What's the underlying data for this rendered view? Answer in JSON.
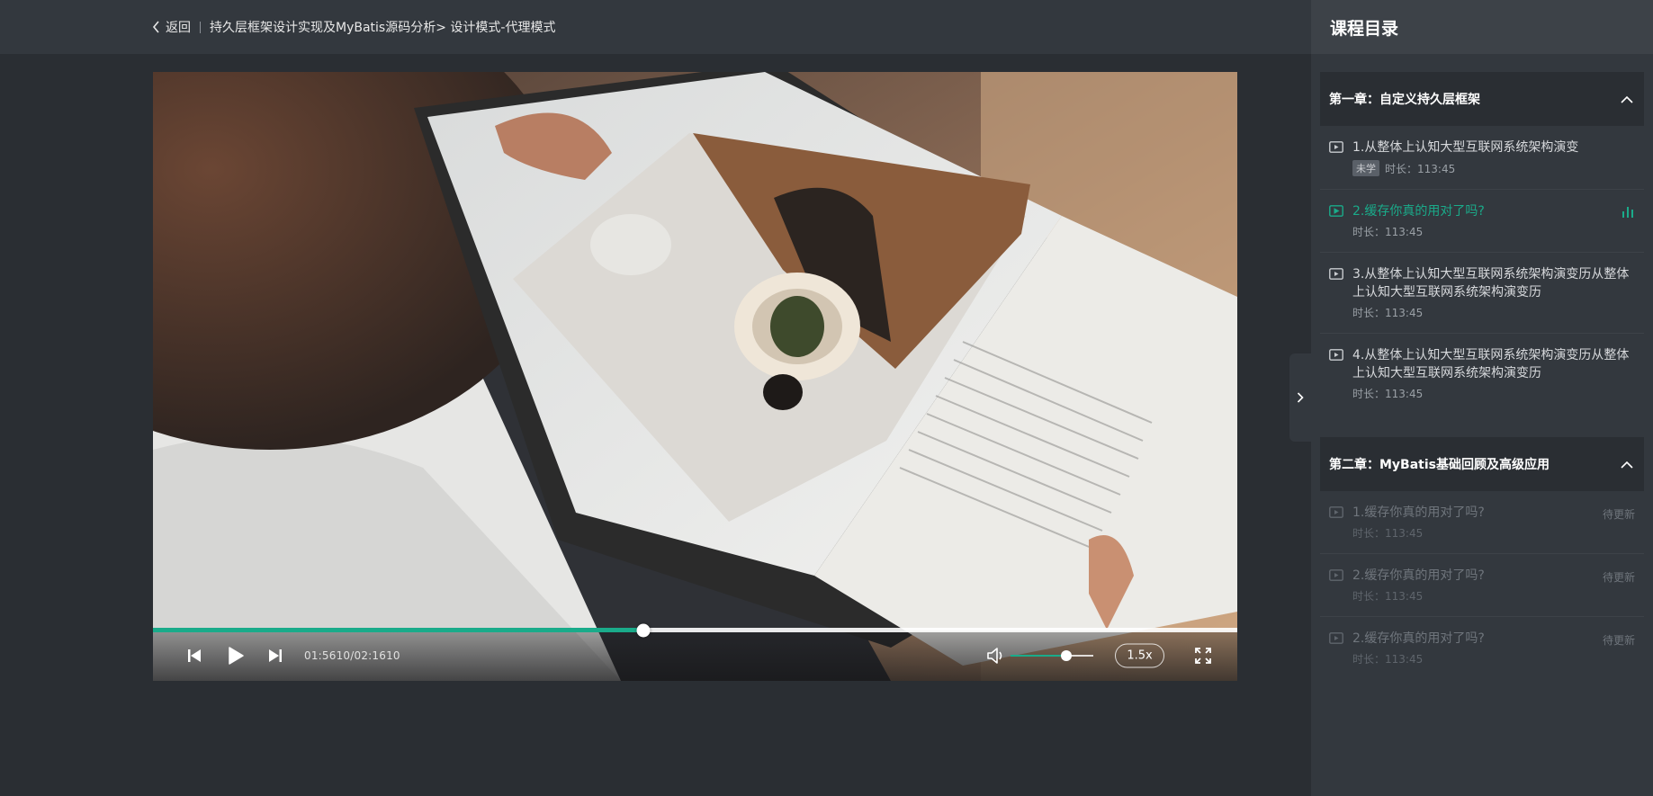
{
  "header": {
    "back_label": "返回",
    "breadcrumb": "持久层框架设计实现及MyBatis源码分析> 设计模式-代理模式"
  },
  "player": {
    "time_display": "01:5610/02:1610",
    "progress": 0.452,
    "volume": 0.67,
    "speed_label": "1.5x"
  },
  "sidebar": {
    "title": "课程目录",
    "chapters": [
      {
        "title": "第一章：自定义持久层框架",
        "lessons": [
          {
            "title": "1.从整体上认知大型互联网系统架构演变",
            "badge": "未学",
            "duration": "时长：113:45"
          },
          {
            "title": "2.缓存你真的用对了吗?",
            "duration": "时长：113:45"
          },
          {
            "title": "3.从整体上认知大型互联网系统架构演变历从整体上认知大型互联网系统架构演变历",
            "duration": "时长：113:45"
          },
          {
            "title": "4.从整体上认知大型互联网系统架构演变历从整体上认知大型互联网系统架构演变历",
            "duration": "时长：113:45"
          }
        ]
      },
      {
        "title": "第二章：MyBatis基础回顾及高级应用",
        "lessons": [
          {
            "title": "1.缓存你真的用对了吗?",
            "duration": "时长：113:45",
            "status": "待更新"
          },
          {
            "title": "2.缓存你真的用对了吗?",
            "duration": "时长：113:45",
            "status": "待更新"
          },
          {
            "title": "2.缓存你真的用对了吗?",
            "duration": "时长：113:45",
            "status": "待更新"
          }
        ]
      }
    ]
  },
  "colors": {
    "accent": "#1aab8a",
    "background": "#2a2e33",
    "panel": "#33383e"
  },
  "icons": {
    "back": "chevron-left-icon",
    "prev": "skip-previous-icon",
    "play": "play-icon",
    "next": "skip-next-icon",
    "volume": "volume-icon",
    "fullscreen": "fullscreen-icon",
    "toggle": "chevron-right-icon",
    "collapse": "chevron-up-icon",
    "lesson": "video-lesson-icon",
    "now_playing": "now-playing-bars-icon"
  }
}
